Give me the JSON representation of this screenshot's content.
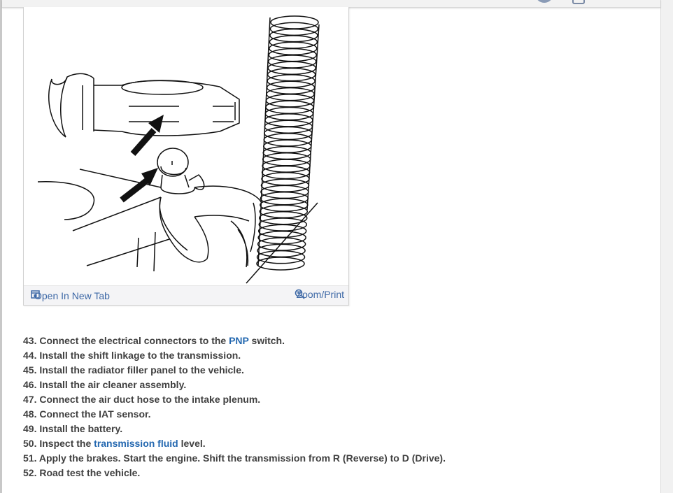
{
  "figure": {
    "open_label": "Open In New Tab",
    "zoom_label": "Zoom/Print",
    "open_icon": "open-new-tab-icon",
    "zoom_icon": "zoom-in-icon"
  },
  "steps": [
    {
      "num": "43.",
      "before": "Connect the electrical connectors to the ",
      "link": "PNP",
      "after": " switch."
    },
    {
      "num": "44.",
      "before": "Install the shift linkage to the transmission.",
      "link": "",
      "after": ""
    },
    {
      "num": "45.",
      "before": "Install the radiator filler panel to the vehicle.",
      "link": "",
      "after": ""
    },
    {
      "num": "46.",
      "before": "Install the air cleaner assembly.",
      "link": "",
      "after": ""
    },
    {
      "num": "47.",
      "before": "Connect the air duct hose to the intake plenum.",
      "link": "",
      "after": ""
    },
    {
      "num": "48.",
      "before": "Connect the IAT sensor.",
      "link": "",
      "after": ""
    },
    {
      "num": "49.",
      "before": "Install the battery.",
      "link": "",
      "after": ""
    },
    {
      "num": "50.",
      "before": "Inspect the ",
      "link": "transmission fluid",
      "after": " level."
    },
    {
      "num": "51.",
      "before": "Apply the brakes. Start the engine. Shift the transmission from R (Reverse) to D (Drive).",
      "link": "",
      "after": ""
    },
    {
      "num": "52.",
      "before": "Road test the vehicle.",
      "link": "",
      "after": ""
    }
  ],
  "colors": {
    "link": "#2468b0",
    "text": "#404040",
    "footer_bg": "#f4f4f6"
  }
}
